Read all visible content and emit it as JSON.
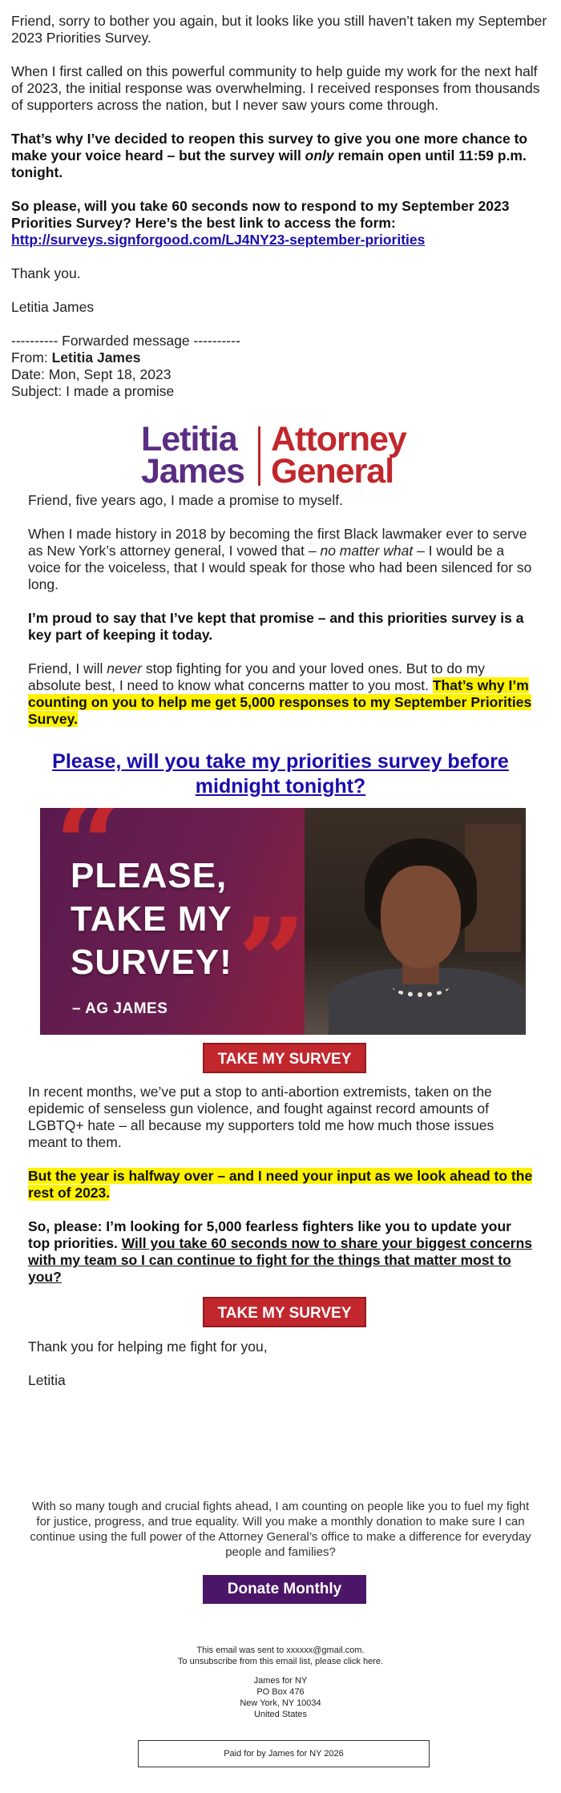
{
  "intro": {
    "p1": "Friend, sorry to bother you again, but it looks like you still haven’t taken my September 2023 Priorities Survey.",
    "p2": "When I first called on this powerful community to help guide my work for the next half of 2023, the initial response was overwhelming. I received responses from thousands of supporters across the nation, but I never saw yours come through.",
    "p3_a": "That’s why I’ve decided to reopen this survey to give you one more chance to make your voice heard – but the survey will ",
    "p3_em": "only",
    "p3_b": " remain open until 11:59 p.m. tonight.",
    "p4": "So please, will you take 60 seconds now to respond to my September 2023 Priorities Survey? Here’s the best link to access the form:",
    "p4_link": "http://surveys.signforgood.com/LJ4NY23-september-priorities",
    "thanks": "Thank you.",
    "signer": "Letitia James"
  },
  "forwarded": {
    "divider": "---------- Forwarded message ----------",
    "from_label": "From: ",
    "from_name": "Letitia James",
    "date": "Date: Mon, Sept 18, 2023",
    "subject": "Subject: I made a promise"
  },
  "logo": {
    "line1": "Letitia",
    "line2": "James",
    "line3": "Attorney",
    "line4": "General"
  },
  "body": {
    "p1": "Friend, five years ago, I made a promise to myself.",
    "p2_a": "When I made history in 2018 by becoming the first Black lawmaker ever to serve as New York’s attorney general, I vowed that – ",
    "p2_em": "no matter what",
    "p2_b": " – I would be a voice for the voiceless, that I would speak for those who had been silenced for so long.",
    "p3": "I’m proud to say that I’ve kept that promise – and this priorities survey is a key part of keeping it today.",
    "p4_a": "Friend, I will ",
    "p4_em": "never",
    "p4_b": " stop fighting for you and your loved ones. But to do my absolute best, I need to know what concerns matter to you most. ",
    "p4_hl": "That’s why I’m counting on you to help me get 5,000 responses to my September Priorities Survey."
  },
  "headline": "Please, will you take my priorities survey before midnight tonight?",
  "hero": {
    "line1": "PLEASE,",
    "line2": "TAKE MY",
    "line3": "SURVEY!",
    "sig": "– AG JAMES"
  },
  "buttons": {
    "survey": "TAKE MY SURVEY",
    "donate": "Donate Monthly"
  },
  "body2": {
    "p1": "In recent months, we’ve put a stop to anti-abortion extremists, taken on the epidemic of senseless gun violence, and fought against record amounts of LGBTQ+ hate – all because my supporters told me how much those issues meant to them.",
    "p2_hl": "But the year is halfway over – and I need your input as we look ahead to the rest of 2023.",
    "p3_bold": "So, please: I’m looking for 5,000 fearless fighters like you to update your top priorities. ",
    "p3_link": "Will you take 60 seconds now to share your biggest concerns with my team so I can continue to fight for the things that matter most to you?"
  },
  "closing": {
    "p1": "Thank you for helping me fight for you,",
    "p2": "Letitia"
  },
  "appeal": "With so many tough and crucial fights ahead, I am counting on people like you to fuel my fight for justice, progress, and true equality. Will you make a monthly donation to make sure I can continue using the full power of the Attorney General’s office to make a difference for everyday people and families?",
  "footer": {
    "sent": "This email was sent to xxxxxx@gmail.com.",
    "unsub": "To unsubscribe from this email list, please click here.",
    "addr1": "James for NY",
    "addr2": "PO Box 476",
    "addr3": "New York, NY 10034",
    "addr4": "United States",
    "paid": "Paid for by James for NY 2026"
  },
  "colors": {
    "brand_purple": "#5b2d82",
    "brand_red": "#c1272d",
    "highlight": "#fff200",
    "donate_bg": "#4b1568",
    "link": "#1a0dab"
  }
}
